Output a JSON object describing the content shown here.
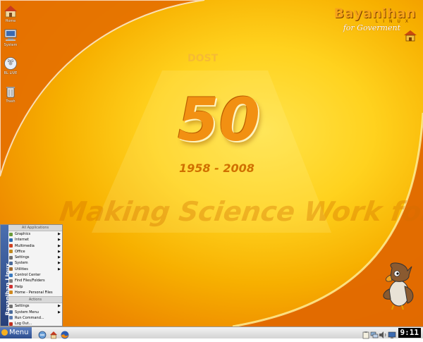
{
  "desktop": {
    "icons": [
      {
        "label": "Home",
        "icon": "home-folder-icon"
      },
      {
        "label": "System",
        "icon": "computer-icon"
      },
      {
        "label": "BL LIVE",
        "icon": "dvd-icon"
      },
      {
        "label": "Trash",
        "icon": "trash-icon"
      }
    ],
    "wallpaper": {
      "brand": "Bayanihan",
      "brand_sub": "LINUX",
      "brand_tag": "for Goverment",
      "dost": "DOST",
      "anniversary": "50",
      "years": "1958 - 2008",
      "motto": "Making Science Work for You"
    }
  },
  "start_menu": {
    "side_label": "Bayanihan Linux",
    "all_apps_header": "All Applications",
    "app_items": [
      {
        "label": "Graphics",
        "submenu": true,
        "color": "#6a9b3c"
      },
      {
        "label": "Internet",
        "submenu": true,
        "color": "#2a6ab0"
      },
      {
        "label": "Multimedia",
        "submenu": true,
        "color": "#d04020"
      },
      {
        "label": "Office",
        "submenu": true,
        "color": "#c08a20"
      },
      {
        "label": "Settings",
        "submenu": true,
        "color": "#707070"
      },
      {
        "label": "System",
        "submenu": true,
        "color": "#4a6a9a"
      },
      {
        "label": "Utilities",
        "submenu": true,
        "color": "#a06a30"
      },
      {
        "label": "Control Center",
        "submenu": false,
        "color": "#3a7ac0"
      },
      {
        "label": "Find Files/Folders",
        "submenu": false,
        "color": "#808080"
      },
      {
        "label": "Help",
        "submenu": false,
        "color": "#d03030"
      },
      {
        "label": "Home - Personal Files",
        "submenu": false,
        "color": "#d08a20"
      }
    ],
    "actions_header": "Actions",
    "action_items": [
      {
        "label": "Settings",
        "submenu": true,
        "color": "#707070"
      },
      {
        "label": "System Menu",
        "submenu": true,
        "color": "#4a6a9a"
      },
      {
        "label": "Run Command...",
        "submenu": false,
        "color": "#5a7ab0"
      },
      {
        "label": "Log Out...",
        "submenu": false,
        "color": "#c03020"
      }
    ]
  },
  "taskbar": {
    "menu_label": "Menu",
    "launchers": [
      "system-icon",
      "home-icon",
      "firefox-icon"
    ],
    "tray_icons": [
      "clipboard-icon",
      "network-icon",
      "volume-icon",
      "display-icon"
    ],
    "clock": "9:11"
  }
}
